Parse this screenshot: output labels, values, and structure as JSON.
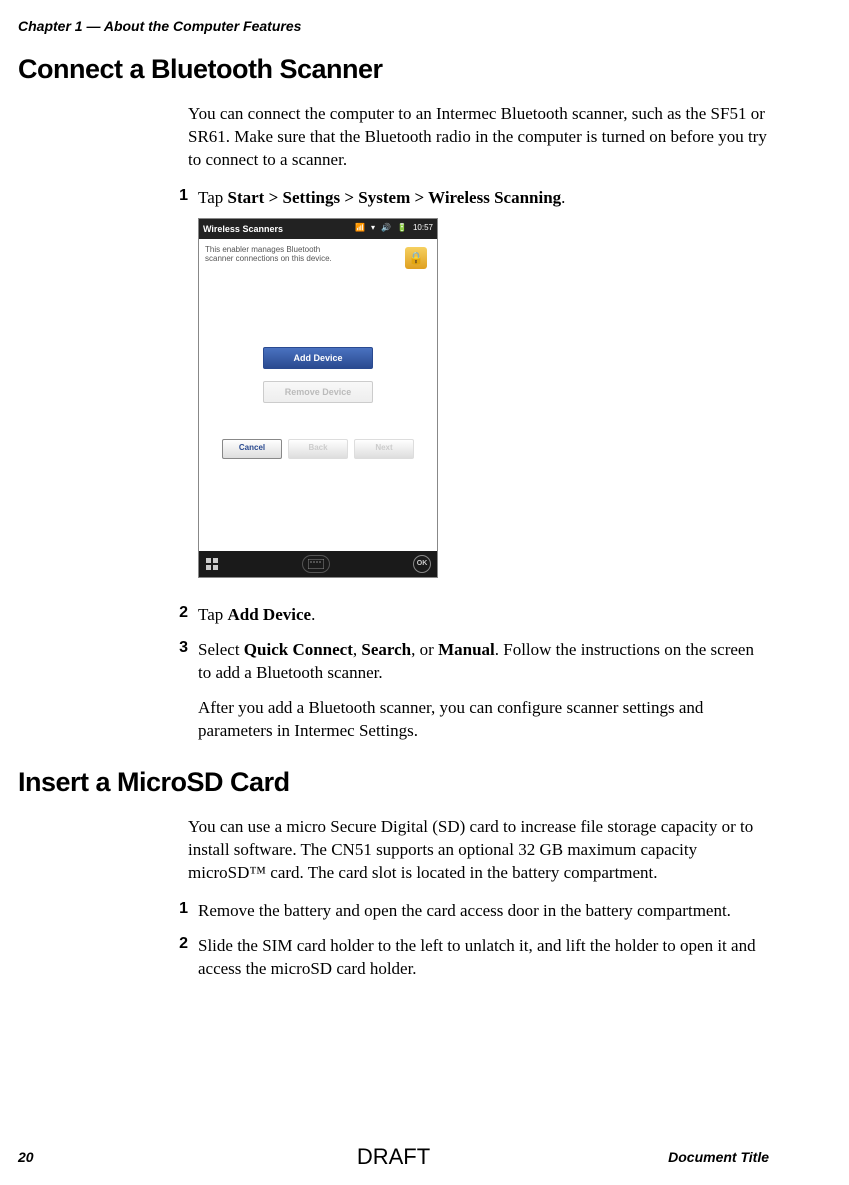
{
  "chapter_header": "Chapter 1 — About the Computer Features",
  "section1": {
    "heading": "Connect a Bluetooth Scanner",
    "intro": "You can connect the computer to an Intermec Bluetooth scanner, such as the SF51 or SR61. Make sure that the Bluetooth radio in the computer is turned on before you try to connect to a scanner.",
    "steps": {
      "s1": {
        "num": "1",
        "prefix": "Tap ",
        "bold": "Start > Settings > System > Wireless Scanning",
        "suffix": "."
      },
      "s2": {
        "num": "2",
        "prefix": "Tap ",
        "bold": "Add Device",
        "suffix": "."
      },
      "s3": {
        "num": "3",
        "prefix": "Select ",
        "b1": "Quick Connect",
        "sep1": ", ",
        "b2": "Search",
        "sep2": ", or ",
        "b3": "Manual",
        "suffix": ". Follow the instructions on the screen to add a Bluetooth scanner.",
        "after": "After you add a Bluetooth scanner, you can configure scanner settings and parameters in Intermec Settings."
      }
    },
    "screenshot": {
      "title": "Wireless Scanners",
      "time": "10:57",
      "enabler_text": "This enabler manages Bluetooth scanner connections on this device.",
      "add_device": "Add Device",
      "remove_device": "Remove Device",
      "cancel": "Cancel",
      "back": "Back",
      "next": "Next",
      "ok": "OK"
    }
  },
  "section2": {
    "heading": "Insert a MicroSD Card",
    "intro": "You can use a micro Secure Digital (SD) card to increase file storage capacity or to install software. The CN51 supports an optional 32 GB maximum capacity microSD™ card. The card slot is located in the battery compartment.",
    "steps": {
      "s1": {
        "num": "1",
        "text": "Remove the battery and open the card access door in the battery compartment."
      },
      "s2": {
        "num": "2",
        "text": "Slide the SIM card holder to the left to unlatch it, and lift the holder to open it and access the microSD card holder."
      }
    }
  },
  "footer": {
    "page": "20",
    "draft": "DRAFT",
    "doc_title": "Document Title"
  }
}
